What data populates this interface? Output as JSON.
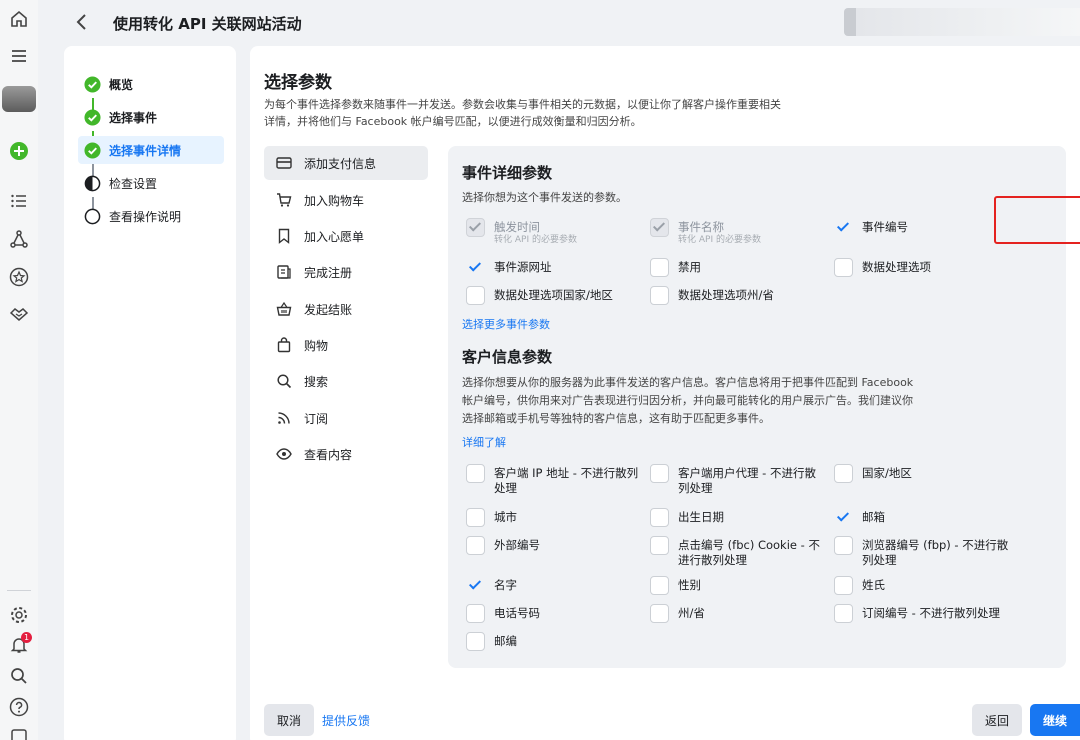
{
  "header": {
    "title": "使用转化 API 关联网站活动"
  },
  "nav_rail": {
    "notification_count": "1"
  },
  "steps": [
    {
      "label": "概览"
    },
    {
      "label": "选择事件"
    },
    {
      "label": "选择事件详情"
    },
    {
      "label": "检查设置"
    },
    {
      "label": "查看操作说明"
    }
  ],
  "main": {
    "title": "选择参数",
    "description": "为每个事件选择参数来随事件一并发送。参数会收集与事件相关的元数据，以便让你了解客户操作重要相关详情，并将他们与 Facebook 帐户编号匹配，以便进行成效衡量和归因分析。"
  },
  "events": [
    {
      "label": "添加支付信息",
      "icon": "credit-card-icon"
    },
    {
      "label": "加入购物车",
      "icon": "cart-icon"
    },
    {
      "label": "加入心愿单",
      "icon": "bookmark-icon"
    },
    {
      "label": "完成注册",
      "icon": "registration-icon"
    },
    {
      "label": "发起结账",
      "icon": "basket-icon"
    },
    {
      "label": "购物",
      "icon": "shopping-bag-icon"
    },
    {
      "label": "搜索",
      "icon": "search-icon"
    },
    {
      "label": "订阅",
      "icon": "rss-icon"
    },
    {
      "label": "查看内容",
      "icon": "eye-icon"
    }
  ],
  "event_params": {
    "title": "事件详细参数",
    "hint": "选择你想为这个事件发送的参数。",
    "items": [
      {
        "label": "触发时间",
        "sub": "转化 API 的必要参数",
        "checked": true,
        "disabled": true
      },
      {
        "label": "事件名称",
        "sub": "转化 API 的必要参数",
        "checked": true,
        "disabled": true
      },
      {
        "label": "事件编号",
        "checked": true
      },
      {
        "label": "事件源网址",
        "checked": true
      },
      {
        "label": "禁用",
        "checked": false
      },
      {
        "label": "数据处理选项",
        "checked": false
      },
      {
        "label": "数据处理选项国家/地区",
        "checked": false
      },
      {
        "label": "数据处理选项州/省",
        "checked": false
      }
    ],
    "more_link": "选择更多事件参数"
  },
  "customer_params": {
    "title": "客户信息参数",
    "hint_lines": [
      "选择你想要从你的服务器为此事件发送的客户信息。客户信息将用于把事件匹配到 Facebook",
      "帐户编号，供你用来对广告表现进行归因分析，并向最可能转化的用户展示广告。我们建议你",
      "选择邮箱或手机号等独特的客户信息，这有助于匹配更多事件。"
    ],
    "learn_more": "详细了解",
    "items": [
      {
        "label": "客户端 IP 地址 - 不进行散列处理",
        "checked": false
      },
      {
        "label": "客户端用户代理 - 不进行散列处理",
        "checked": false
      },
      {
        "label": "国家/地区",
        "checked": false
      },
      {
        "label": "城市",
        "checked": false
      },
      {
        "label": "出生日期",
        "checked": false
      },
      {
        "label": "邮箱",
        "checked": true
      },
      {
        "label": "外部编号",
        "checked": false
      },
      {
        "label": "点击编号 (fbc) Cookie - 不进行散列处理",
        "checked": false
      },
      {
        "label": "浏览器编号 (fbp) - 不进行散列处理",
        "checked": false
      },
      {
        "label": "名字",
        "checked": true
      },
      {
        "label": "性别",
        "checked": false
      },
      {
        "label": "姓氏",
        "checked": false
      },
      {
        "label": "电话号码",
        "checked": false
      },
      {
        "label": "州/省",
        "checked": false
      },
      {
        "label": "订阅编号 - 不进行散列处理",
        "checked": false
      },
      {
        "label": "邮编",
        "checked": false
      }
    ]
  },
  "footer": {
    "cancel": "取消",
    "feedback": "提供反馈",
    "back": "返回",
    "continue": "继续"
  },
  "colors": {
    "accent": "#1877f2",
    "success": "#42b72a",
    "highlight": "#e4221f"
  }
}
